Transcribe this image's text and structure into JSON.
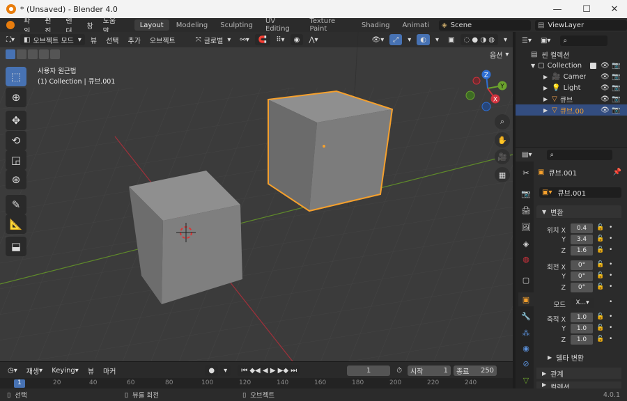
{
  "window": {
    "title": "* (Unsaved) - Blender 4.0",
    "min": "—",
    "max": "☐",
    "close": "✕"
  },
  "menu": [
    "파일",
    "편집",
    "렌더",
    "창",
    "도움말"
  ],
  "workspaces": [
    "Layout",
    "Modeling",
    "Sculpting",
    "UV Editing",
    "Texture Paint",
    "Shading",
    "Animati"
  ],
  "scene": {
    "name": "Scene",
    "view_layer": "ViewLayer"
  },
  "viewport": {
    "mode": "오브젝트 모드",
    "menus": [
      "뷰",
      "선택",
      "추가",
      "오브젝트"
    ],
    "transform_orientation": "글로벌",
    "options_label": "옵션",
    "info_line1": "사용자 원근법",
    "info_line2": "(1) Collection | 큐브.001",
    "gizmo": {
      "z": "Z",
      "y": "Y",
      "x": "X"
    }
  },
  "outliner": {
    "scene_collection": "씬 컬렉션",
    "items": [
      {
        "label": "Collection",
        "icon": "collection-icon"
      },
      {
        "label": "Camera",
        "icon": "camera-icon"
      },
      {
        "label": "Light",
        "icon": "light-icon"
      },
      {
        "label": "큐브",
        "icon": "mesh-icon"
      },
      {
        "label": "큐브.00",
        "icon": "mesh-icon",
        "selected": true
      }
    ]
  },
  "properties": {
    "object_name": "큐브.001",
    "object_field": "큐브.001",
    "transform_header": "변환",
    "location_label": "위치 X",
    "location": [
      "0.4",
      "3.4",
      "1.6"
    ],
    "rotation_label": "회전 X",
    "rotation": [
      "0°",
      "0°",
      "0°"
    ],
    "mode_label": "모드",
    "mode_value": "X...",
    "scale_label": "축적 X",
    "scale": [
      "1.0",
      "1.0",
      "1.0"
    ],
    "axis_y": "Y",
    "axis_z": "Z",
    "delta_transform": "델타 변환",
    "relations": "관계",
    "collections": "컬렉션"
  },
  "timeline": {
    "playback": "재생",
    "keying": "Keying",
    "view": "뷰",
    "marker": "마커",
    "current_frame": "1",
    "start_label": "시작",
    "start": "1",
    "end_label": "종료",
    "end": "250",
    "ruler": [
      "1",
      "20",
      "40",
      "60",
      "80",
      "100",
      "120",
      "140",
      "160",
      "180",
      "200",
      "220",
      "240"
    ]
  },
  "status": {
    "select": "선택",
    "rotate_view": "뷰를 회전",
    "object": "오브젝트",
    "version": "4.0.1"
  },
  "colors": {
    "accent": "#4772b3",
    "selection": "#f5a02d",
    "x_axis": "#d0323d",
    "y_axis": "#6ba32d",
    "z_axis": "#2e6fd4"
  }
}
